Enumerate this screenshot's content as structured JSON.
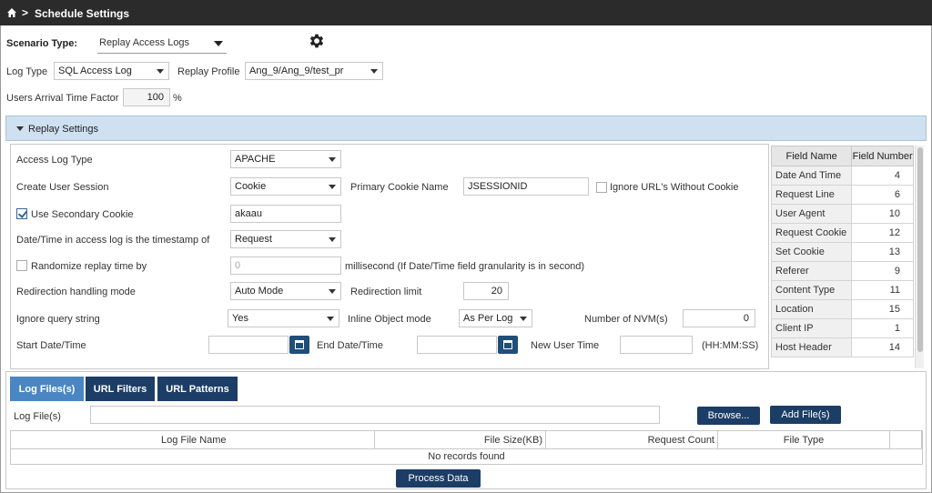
{
  "header": {
    "breadcrumb_chevron": ">",
    "title": "Schedule Settings"
  },
  "scenario": {
    "label": "Scenario Type:",
    "value": "Replay Access Logs"
  },
  "log_type": {
    "label": "Log Type",
    "value": "SQL Access Log"
  },
  "replay_profile": {
    "label": "Replay Profile",
    "value": "Ang_9/Ang_9/test_pr"
  },
  "arrival": {
    "label": "Users Arrival Time Factor",
    "value": "100",
    "unit": "%"
  },
  "replay_settings": {
    "title": "Replay Settings",
    "access_log_type": {
      "label": "Access Log Type",
      "value": "APACHE"
    },
    "create_user_session": {
      "label": "Create User Session",
      "value": "Cookie"
    },
    "primary_cookie": {
      "label": "Primary Cookie Name",
      "value": "JSESSIONID"
    },
    "ignore_urls": {
      "label": "Ignore URL's Without Cookie",
      "checked": false
    },
    "secondary_cookie": {
      "label": "Use Secondary Cookie",
      "checked": true,
      "value": "akaau"
    },
    "timestamp": {
      "label": "Date/Time in access log is the timestamp of",
      "value": "Request"
    },
    "randomize": {
      "label": "Randomize replay time by",
      "checked": false,
      "value": "0",
      "suffix": "millisecond (If Date/Time field granularity is in second)"
    },
    "redirection_mode": {
      "label": "Redirection handling mode",
      "value": "Auto Mode"
    },
    "redirection_limit": {
      "label": "Redirection limit",
      "value": "20"
    },
    "ignore_query": {
      "label": "Ignore query string",
      "value": "Yes"
    },
    "inline_object": {
      "label": "Inline Object mode",
      "value": "As Per Log"
    },
    "nvm": {
      "label": "Number of NVM(s)",
      "value": "0"
    },
    "start_date": {
      "label": "Start Date/Time",
      "value": ""
    },
    "end_date": {
      "label": "End Date/Time",
      "value": ""
    },
    "new_user_time": {
      "label": "New User Time",
      "value": "",
      "suffix": "(HH:MM:SS)"
    }
  },
  "field_table": {
    "headers": [
      "Field Name",
      "Field Number"
    ],
    "rows": [
      {
        "name": "Date And Time",
        "number": "4"
      },
      {
        "name": "Request Line",
        "number": "6"
      },
      {
        "name": "User Agent",
        "number": "10"
      },
      {
        "name": "Request Cookie",
        "number": "12"
      },
      {
        "name": "Set Cookie",
        "number": "13"
      },
      {
        "name": "Referer",
        "number": "9"
      },
      {
        "name": "Content Type",
        "number": "11"
      },
      {
        "name": "Location",
        "number": "15"
      },
      {
        "name": "Client IP",
        "number": "1"
      },
      {
        "name": "Host Header",
        "number": "14"
      }
    ]
  },
  "tabs": [
    {
      "label": "Log Files(s)",
      "active": true
    },
    {
      "label": "URL Filters",
      "active": false
    },
    {
      "label": "URL Patterns",
      "active": false
    }
  ],
  "log_files": {
    "label": "Log File(s)",
    "input_value": "",
    "browse_label": "Browse...",
    "add_label": "Add File(s)",
    "columns": [
      "Log File Name",
      "File Size(KB)",
      "Request Count",
      "File Type"
    ],
    "empty_text": "No records found",
    "process_label": "Process Data"
  },
  "colors": {
    "header_bg": "#2b2b2b",
    "section_bg": "#cfe0f0",
    "button_bg": "#1c3d66",
    "active_tab": "#4a86c2"
  }
}
